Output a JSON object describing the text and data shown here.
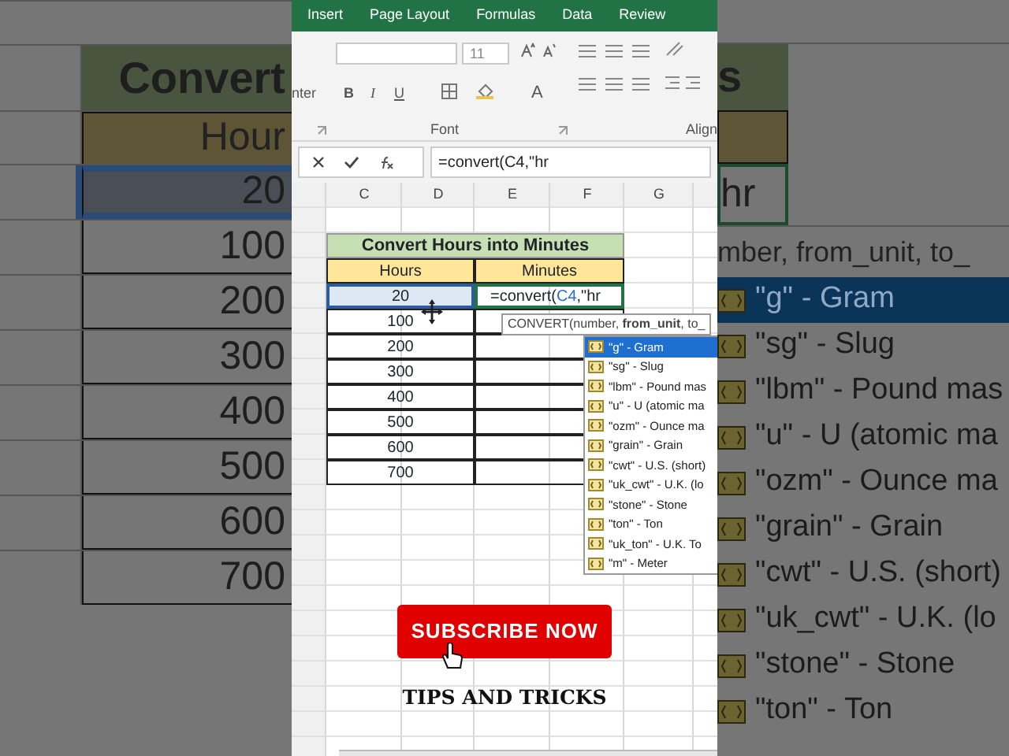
{
  "left_backdrop": {
    "title": "Convert",
    "header": "Hour",
    "rows": [
      {
        "value": "20",
        "selected": true
      },
      {
        "value": "100",
        "selected": false
      },
      {
        "value": "200",
        "selected": false
      },
      {
        "value": "300",
        "selected": false
      },
      {
        "value": "400",
        "selected": false
      },
      {
        "value": "500",
        "selected": false
      },
      {
        "value": "600",
        "selected": false
      },
      {
        "value": "700",
        "selected": false
      }
    ]
  },
  "ribbon": {
    "tabs": [
      "Insert",
      "Page Layout",
      "Formulas",
      "Data",
      "Review"
    ],
    "cut_label": "nter",
    "font_size": "11",
    "bold": "B",
    "italic": "I",
    "underline": "U",
    "font_color": "A",
    "groups": [
      "Font",
      "Align"
    ]
  },
  "formula_bar": {
    "formula": "=convert(C4,\"hr"
  },
  "sheet": {
    "columns": [
      "C",
      "D",
      "E",
      "F",
      "G"
    ],
    "title": "Convert Hours into Minutes",
    "headers": [
      "Hours",
      "Minutes"
    ],
    "rows": [
      {
        "hours": "20",
        "selected": true,
        "editing": [
          {
            "text": "=convert(",
            "kind": "plain"
          },
          {
            "text": "C4",
            "kind": "ref"
          },
          {
            "text": ",\"hr",
            "kind": "plain"
          }
        ]
      },
      {
        "hours": "100",
        "selected": false
      },
      {
        "hours": "200",
        "selected": false
      },
      {
        "hours": "300",
        "selected": false
      },
      {
        "hours": "400",
        "selected": false
      },
      {
        "hours": "500",
        "selected": false
      },
      {
        "hours": "600",
        "selected": false
      },
      {
        "hours": "700",
        "selected": false
      }
    ]
  },
  "tooltip": "CONVERT(number, **from_unit**, to_",
  "autocomplete": [
    {
      "label": "\"g\" - Gram",
      "selected": true
    },
    {
      "label": "\"sg\" - Slug",
      "selected": false
    },
    {
      "label": "\"lbm\" - Pound mas",
      "selected": false
    },
    {
      "label": "\"u\" - U (atomic ma",
      "selected": false
    },
    {
      "label": "\"ozm\" - Ounce ma",
      "selected": false
    },
    {
      "label": "\"grain\" - Grain",
      "selected": false
    },
    {
      "label": "\"cwt\" - U.S. (short)",
      "selected": false
    },
    {
      "label": "\"uk_cwt\" - U.K. (lo",
      "selected": false
    },
    {
      "label": "\"stone\" - Stone",
      "selected": false
    },
    {
      "label": "\"ton\" - Ton",
      "selected": false
    },
    {
      "label": "\"uk_ton\" - U.K. To",
      "selected": false
    },
    {
      "label": "\"m\" - Meter",
      "selected": false
    }
  ],
  "subscribe_button": "SUBSCRIBE NOW",
  "caption": "TIPS AND TRICKS",
  "right_backdrop": {
    "title": "s",
    "cell": "hr",
    "tooltip": "mber, from_unit, to_",
    "items": [
      {
        "label": "\"g\" - Gram",
        "selected": true
      },
      {
        "label": "\"sg\" - Slug",
        "selected": false
      },
      {
        "label": "\"lbm\" - Pound mas",
        "selected": false
      },
      {
        "label": "\"u\" - U (atomic ma",
        "selected": false
      },
      {
        "label": "\"ozm\" - Ounce ma",
        "selected": false
      },
      {
        "label": "\"grain\" - Grain",
        "selected": false
      },
      {
        "label": "\"cwt\" - U.S. (short)",
        "selected": false
      },
      {
        "label": "\"uk_cwt\" - U.K. (lo",
        "selected": false
      },
      {
        "label": "\"stone\" - Stone",
        "selected": false
      },
      {
        "label": "\"ton\" - Ton",
        "selected": false
      }
    ]
  }
}
